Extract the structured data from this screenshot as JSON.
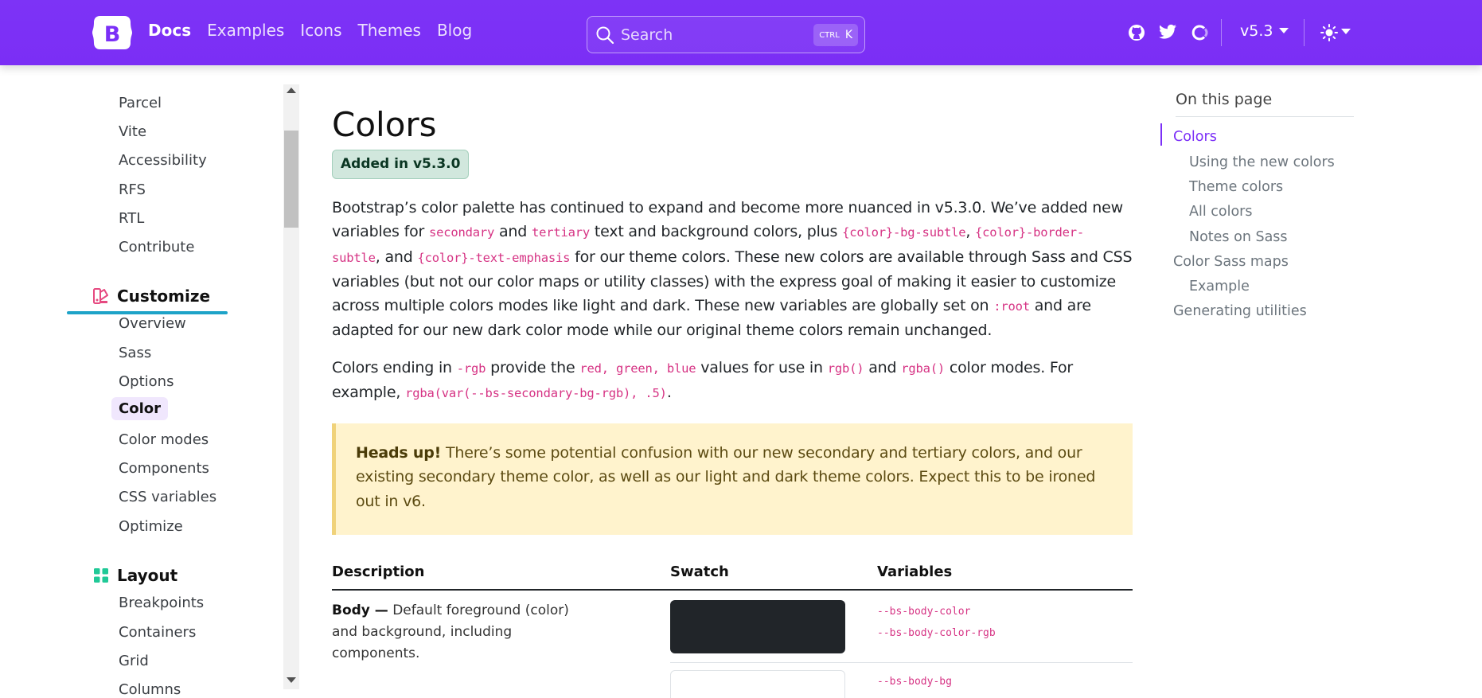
{
  "navbar": {
    "links": [
      "Docs",
      "Examples",
      "Icons",
      "Themes",
      "Blog"
    ],
    "search_placeholder": "Search",
    "kbd_ctrl": "CTRL",
    "kbd_key": "K",
    "version": "v5.3",
    "accent": "#7b2ff7",
    "icons": [
      "github-icon",
      "twitter-icon",
      "opencollective-icon",
      "sun-icon"
    ]
  },
  "sidebar": {
    "top_items": [
      "Parcel",
      "Vite",
      "Accessibility",
      "RFS",
      "RTL",
      "Contribute"
    ],
    "customize": {
      "label": "Customize",
      "items": [
        "Overview",
        "Sass",
        "Options",
        "Color",
        "Color modes",
        "Components",
        "CSS variables",
        "Optimize"
      ],
      "active": "Color"
    },
    "layout": {
      "label": "Layout",
      "items": [
        "Breakpoints",
        "Containers",
        "Grid",
        "Columns"
      ]
    }
  },
  "main": {
    "title": "Colors",
    "badge": "Added in v5.3.0",
    "p1": {
      "t1": "Bootstrap’s color palette has continued to expand and become more nuanced in v5.3.0. We’ve added new variables for ",
      "c1": "secondary",
      "t2": " and ",
      "c2": "tertiary",
      "t3": " text and background colors, plus ",
      "c3": "{color}-bg-subtle",
      "t4": ", ",
      "c4a": "{color}-border-",
      "c4b": "subtle",
      "t5": ", and ",
      "c5": "{color}-text-emphasis",
      "t6": " for our theme colors. These new colors are available through Sass and CSS variables (but not our color maps or utility classes) with the express goal of making it easier to customize across multiple colors modes like light and dark. These new variables are globally set on ",
      "c6": ":root",
      "t7": " and are adapted for our new dark color mode while our original theme colors remain unchanged."
    },
    "p2": {
      "t1": "Colors ending in ",
      "c1": "-rgb",
      "t2": " provide the ",
      "c2": "red, green, blue",
      "t3": " values for use in ",
      "c3": "rgb()",
      "t4": " and ",
      "c4": "rgba()",
      "t5": " color modes. For example, ",
      "c5": "rgba(var(--bs-secondary-bg-rgb), .5)",
      "t6": "."
    },
    "alert": {
      "strong": "Heads up!",
      "text": " There’s some potential confusion with our new secondary and tertiary colors, and our existing secondary theme color, as well as our light and dark theme colors. Expect this to be ironed out in v6."
    },
    "table": {
      "headers": [
        "Description",
        "Swatch",
        "Variables"
      ],
      "row1": {
        "name": "Body —",
        "desc": " Default foreground (color) and background, including components.",
        "vars": [
          "--bs-body-color",
          "--bs-body-color-rgb"
        ],
        "swatch_color": "#212529"
      },
      "row2": {
        "vars": [
          "--bs-body-bg"
        ],
        "swatch_color": "#ffffff"
      }
    }
  },
  "toc": {
    "title": "On this page",
    "items": [
      "Colors",
      "Using the new colors",
      "Theme colors",
      "All colors",
      "Notes on Sass",
      "Color Sass maps",
      "Example",
      "Generating utilities"
    ],
    "active": "Colors"
  }
}
